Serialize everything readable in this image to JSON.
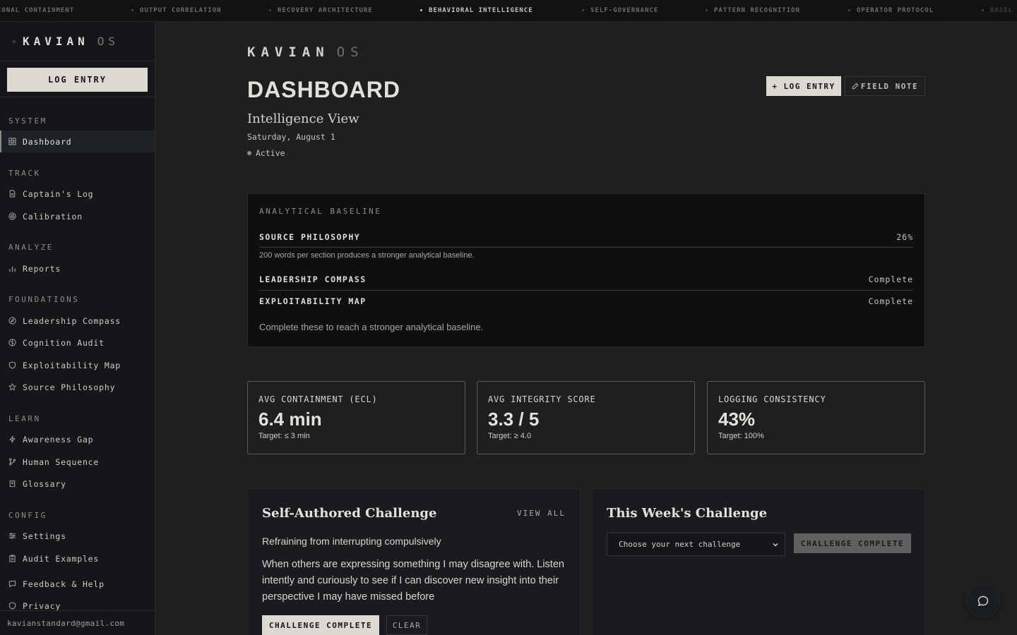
{
  "ticker": [
    {
      "label": "IONAL CONTAINMENT",
      "state": "partial"
    },
    {
      "label": "OUTPUT CORRELATION",
      "state": "normal"
    },
    {
      "label": "RECOVERY ARCHITECTURE",
      "state": "normal"
    },
    {
      "label": "BEHAVIORAL INTELLIGENCE",
      "state": "active"
    },
    {
      "label": "SELF-GOVERNANCE",
      "state": "normal"
    },
    {
      "label": "PATTERN RECOGNITION",
      "state": "normal"
    },
    {
      "label": "OPERATOR PROTOCOL",
      "state": "normal"
    },
    {
      "label": "BASEL",
      "state": "fade"
    }
  ],
  "sidebar": {
    "brand": "KAVIAN",
    "brand_suffix": "OS",
    "log_button": "LOG ENTRY",
    "sections": {
      "system": "SYSTEM",
      "track": "TRACK",
      "analyze": "ANALYZE",
      "foundations": "FOUNDATIONS",
      "learn": "LEARN",
      "config": "CONFIG"
    },
    "items": {
      "dashboard": "Dashboard",
      "captains_log": "Captain's Log",
      "calibration": "Calibration",
      "reports": "Reports",
      "leadership_compass": "Leadership Compass",
      "cognition_audit": "Cognition Audit",
      "exploitability_map": "Exploitability Map",
      "source_philosophy": "Source Philosophy",
      "awareness_gap": "Awareness Gap",
      "human_sequence": "Human Sequence",
      "glossary": "Glossary",
      "settings": "Settings",
      "audit_examples": "Audit Examples",
      "feedback": "Feedback & Help",
      "privacy": "Privacy"
    },
    "user_email": "kavianstandard@gmail.com"
  },
  "header": {
    "brand": "KAVIAN",
    "brand_suffix": "OS",
    "title": "DASHBOARD",
    "subtitle": "Intelligence View",
    "date": "Saturday, August 1",
    "status": "Active",
    "log_entry_button": "+ LOG ENTRY",
    "field_note_button": "FIELD NOTE"
  },
  "baseline": {
    "title": "ANALYTICAL BASELINE",
    "rows": [
      {
        "label": "SOURCE PHILOSOPHY",
        "value": "26%"
      },
      {
        "label": "LEADERSHIP COMPASS",
        "value": "Complete"
      },
      {
        "label": "EXPLOITABILITY MAP",
        "value": "Complete"
      }
    ],
    "hint": "200 words per section produces a stronger analytical baseline.",
    "footer": "Complete these to reach a stronger analytical baseline."
  },
  "stats": [
    {
      "label": "AVG CONTAINMENT (ECL)",
      "value": "6.4 min",
      "target": "Target: ≤ 3 min"
    },
    {
      "label": "AVG INTEGRITY SCORE",
      "value": "3.3 / 5",
      "target": "Target: ≥ 4.0"
    },
    {
      "label": "LOGGING CONSISTENCY",
      "value": "43%",
      "target": "Target: 100%"
    }
  ],
  "self_challenge": {
    "title": "Self-Authored Challenge",
    "view_all": "VIEW ALL",
    "name": "Refraining from interrupting compulsively",
    "description": "When others are expressing something I may disagree with. Listen intently and curiously to see if I can discover new insight into their perspective I may have missed before",
    "complete_button": "CHALLENGE COMPLETE",
    "clear_button": "CLEAR"
  },
  "week_challenge": {
    "title": "This Week's Challenge",
    "select_value": "Choose your next challenge",
    "complete_button": "CHALLENGE COMPLETE"
  },
  "colors": {
    "background": "#1f1f1f",
    "sidebar": "#141619",
    "accent": "#dcd9d3",
    "card": "#0e0f11"
  }
}
